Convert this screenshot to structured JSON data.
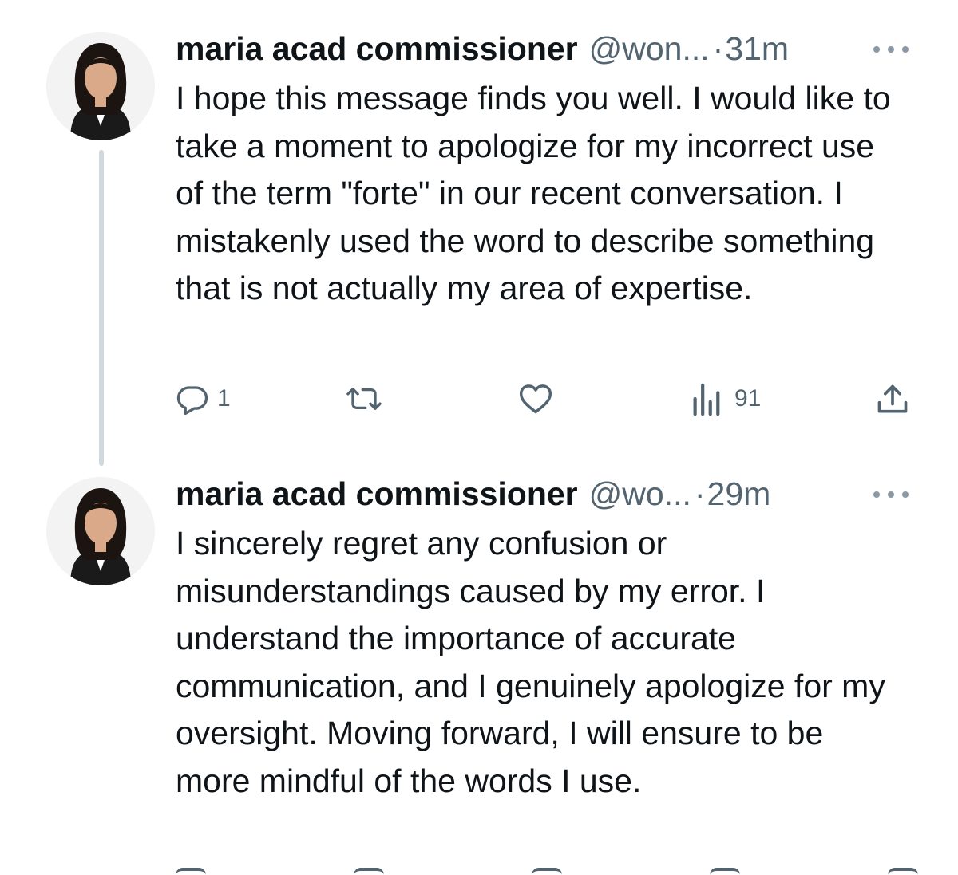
{
  "tweets": [
    {
      "name": "maria acad commissioner",
      "handle": "@won...",
      "dot": "·",
      "time": "31m",
      "text": "I hope this message finds you well. I would like to take a moment to apologize for my incorrect use of the term \"forte\" in our recent conversation. I mistakenly used the word to describe something that is not actually my area of expertise.",
      "actions": {
        "reply_count": "1",
        "retweet_count": "",
        "like_count": "",
        "views_count": "91"
      }
    },
    {
      "name": "maria acad commissioner",
      "handle": "@wo...",
      "dot": "·",
      "time": "29m",
      "text": "I sincerely regret any confusion or misunderstandings caused by my error. I understand the importance of accurate communication, and I genuinely apologize for my oversight. Moving forward, I will ensure to be more mindful of the words I use."
    }
  ],
  "colors": {
    "text": "#0f1419",
    "secondary": "#536471",
    "thread_line": "#cfd9de"
  },
  "icons": [
    "reply-icon",
    "retweet-icon",
    "like-icon",
    "views-icon",
    "share-icon",
    "more-icon"
  ]
}
